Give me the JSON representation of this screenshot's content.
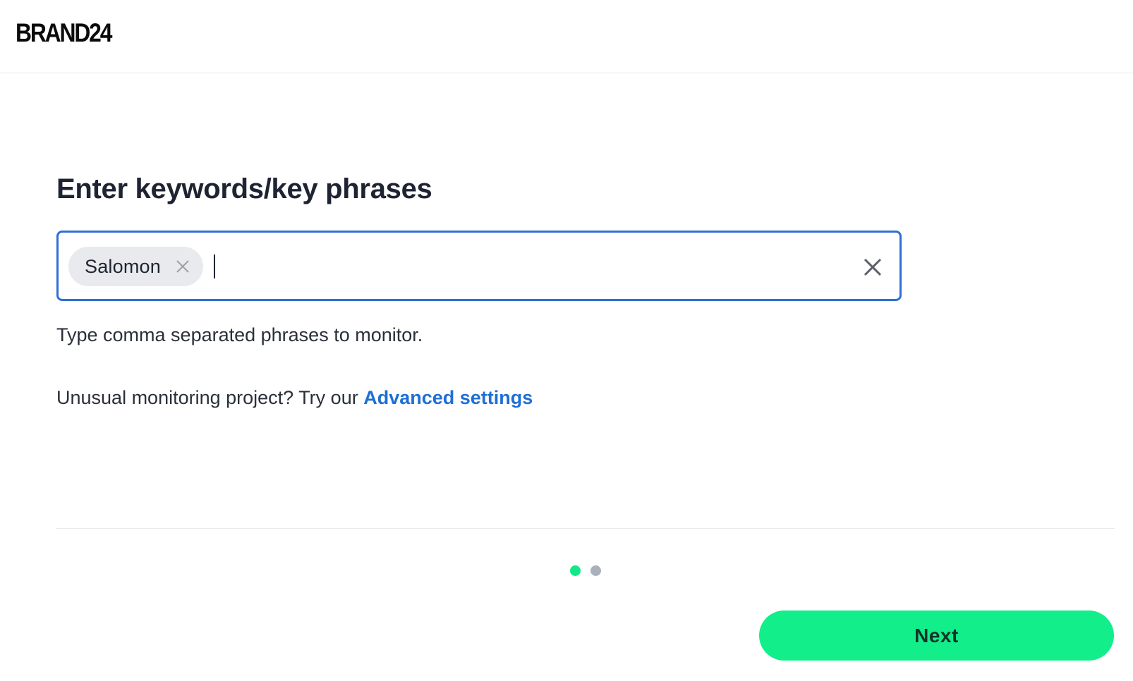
{
  "header": {
    "logo_text": "BRAND24"
  },
  "main": {
    "title": "Enter keywords/key phrases",
    "keywords_input": {
      "chips": [
        {
          "label": "Salomon"
        }
      ],
      "value": ""
    },
    "hint": "Type comma separated phrases to monitor.",
    "advanced_prefix": "Unusual monitoring project? Try our ",
    "advanced_link": "Advanced settings"
  },
  "stepper": {
    "current_step": 1,
    "total_steps": 2
  },
  "footer": {
    "next_label": "Next"
  },
  "colors": {
    "accent_green": "#12ee8a",
    "link_blue": "#1d6fd6",
    "input_border": "#2f6fd6",
    "dot_inactive": "#aab1bb"
  },
  "icons": {
    "chip_remove": "close-icon",
    "clear_input": "close-icon"
  }
}
